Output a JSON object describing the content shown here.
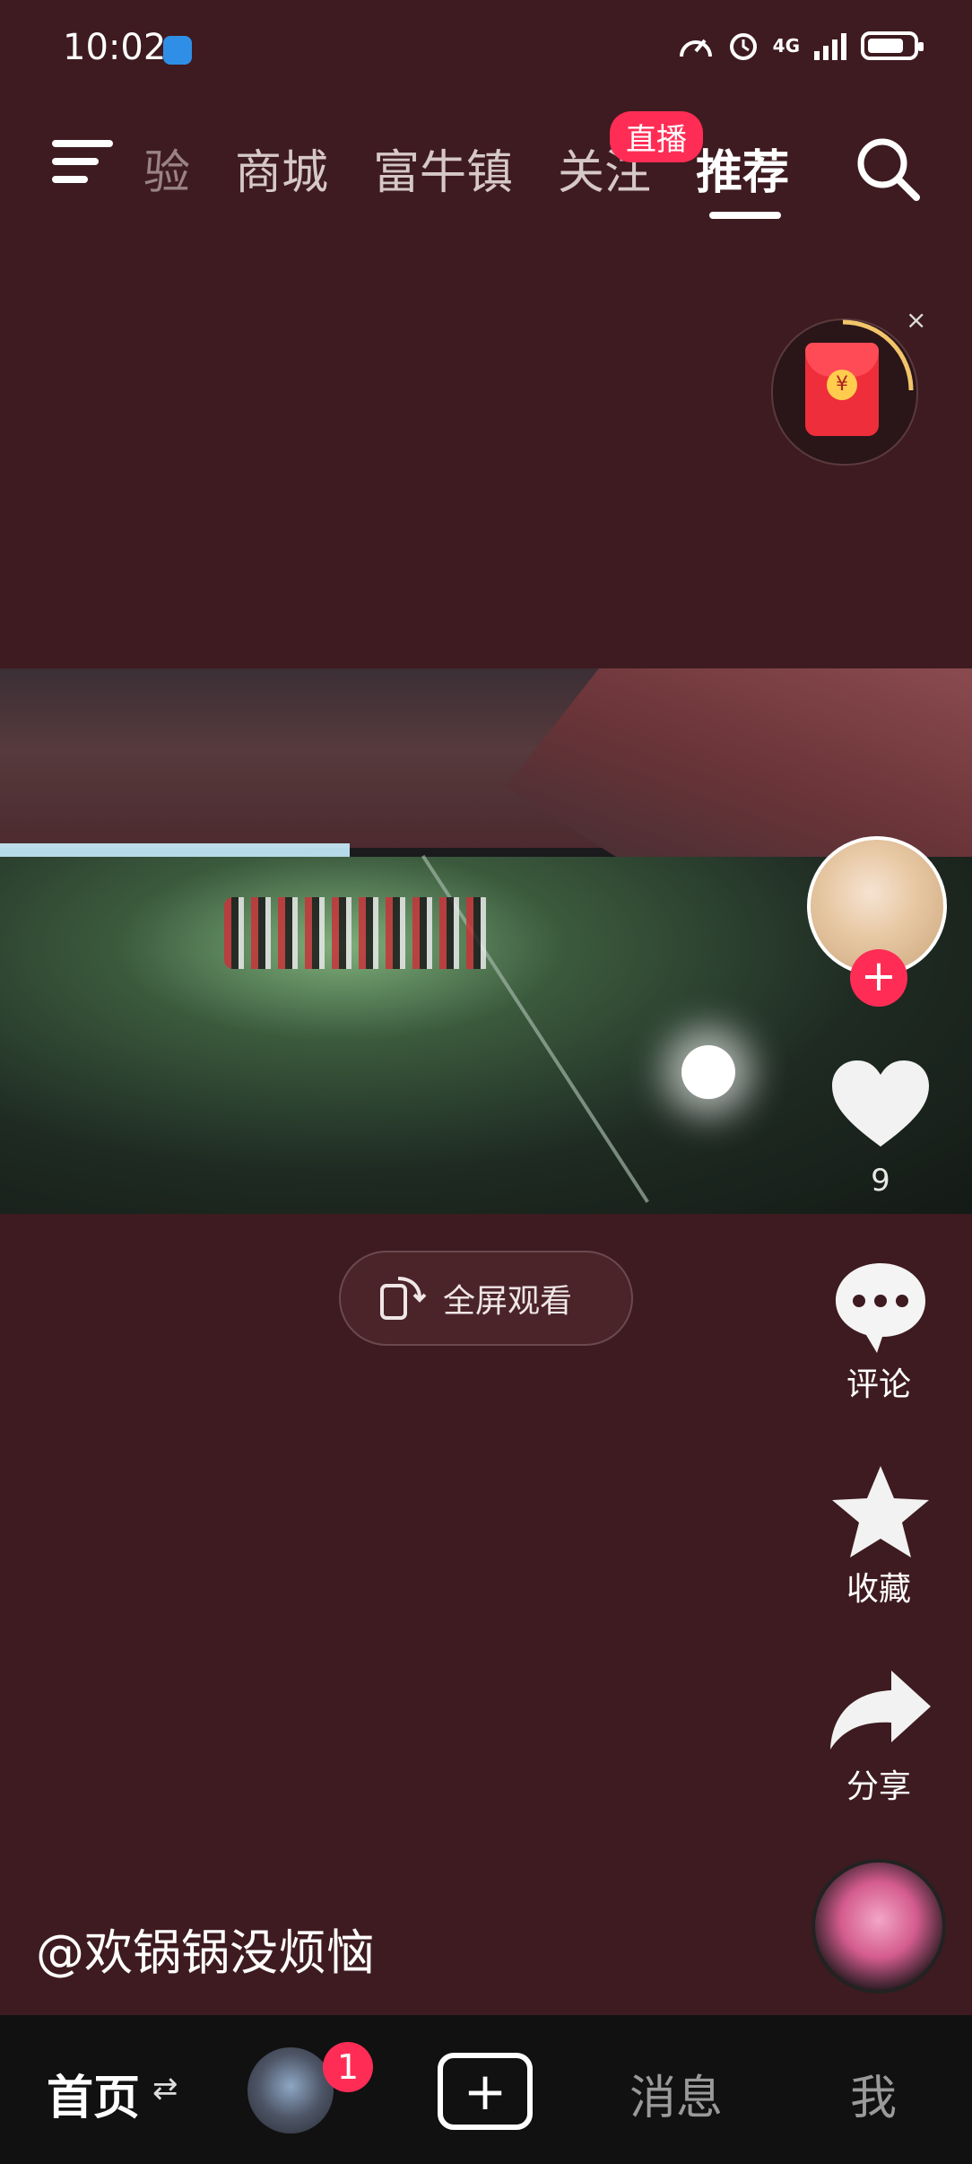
{
  "status_bar": {
    "time": "10:02",
    "network": "4G"
  },
  "nav": {
    "tabs": [
      "验",
      "商城",
      "富牛镇",
      "关注",
      "推荐"
    ],
    "active_tab": "推荐",
    "live_badge": "直播"
  },
  "redpack": {
    "close": "×",
    "coin": "¥"
  },
  "video": {
    "fullscreen_label": "全屏观看"
  },
  "actions": {
    "like_count": "9",
    "comment_label": "评论",
    "favorite_label": "收藏",
    "share_label": "分享",
    "follow_plus": "+"
  },
  "author": {
    "name": "@欢锅锅没烦恼"
  },
  "bottom_nav": {
    "home": "首页",
    "swap_icon": "⇄",
    "badge": "1",
    "add": "+",
    "messages": "消息",
    "me": "我"
  },
  "colors": {
    "background": "#3e1b20",
    "accent": "#ff2d55"
  }
}
